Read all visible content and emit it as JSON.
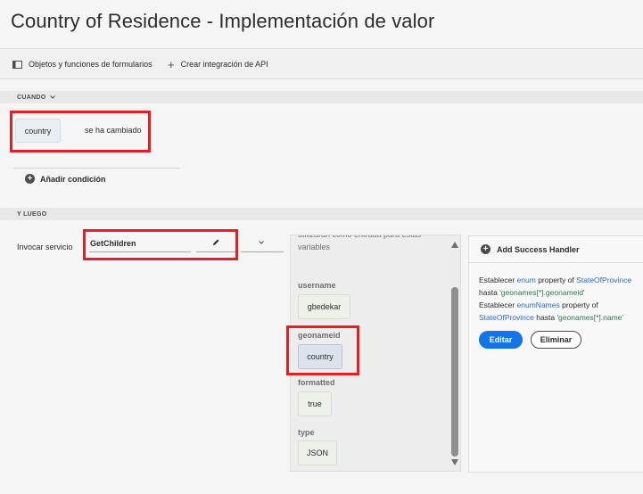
{
  "header": {
    "title": "Country of Residence - Implementación de valor"
  },
  "toolbar": {
    "forms_objects_label": "Objetos y funciones de formularios",
    "create_api_label": "Crear integración de API"
  },
  "when_section": {
    "label": "CUANDO",
    "condition": {
      "field": "country",
      "event": "se ha cambiado"
    },
    "add_condition_label": "Añadir condición"
  },
  "then_section": {
    "label": "Y LUEGO",
    "action_label": "Invocar servicio",
    "service_name": "GetChildren"
  },
  "input_panel": {
    "description": "utilizarán como entrada para estas variables",
    "params": [
      {
        "label": "username",
        "value": "gbedekar"
      },
      {
        "label": "geonameid",
        "value": "country"
      },
      {
        "label": "formatted",
        "value": "true"
      },
      {
        "label": "type",
        "value": "JSON"
      }
    ]
  },
  "success_panel": {
    "header": "Add Success Handler",
    "line1_prefix": "Establecer",
    "line1_prop": "enum",
    "line1_mid": "property of",
    "line1_target": "StateOfProvince",
    "line2_prefix": "hasta",
    "line2_value": "'geonames[*].geonameid'",
    "line3_prefix": "Establecer",
    "line3_prop": "enumNames",
    "line3_mid": "property of",
    "line4_target": "StateOfProvince",
    "line4_mid": "hasta",
    "line4_value": "'geonames[*].name'",
    "edit_label": "Editar",
    "delete_label": "Eliminar"
  },
  "colors": {
    "highlight": "#e31e24",
    "primary": "#1473e6",
    "link_blue": "#2d6bc6",
    "value_green": "#2b7a4b"
  }
}
